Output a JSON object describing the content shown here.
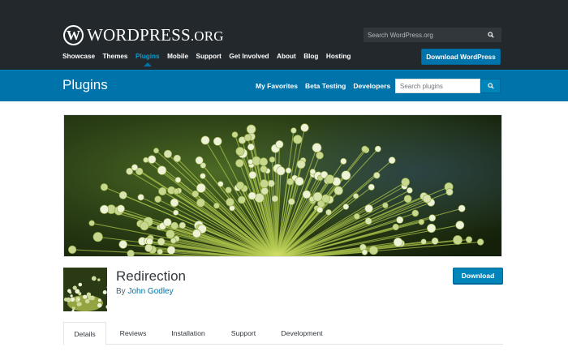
{
  "header": {
    "logo_mark": "W",
    "logo_text": "WORDPRESS",
    "logo_suffix": ".ORG",
    "search_placeholder": "Search WordPress.org",
    "search_icon": "search-icon",
    "nav": [
      {
        "label": "Showcase"
      },
      {
        "label": "Themes"
      },
      {
        "label": "Plugins"
      },
      {
        "label": "Mobile"
      },
      {
        "label": "Support"
      },
      {
        "label": "Get Involved"
      },
      {
        "label": "About"
      },
      {
        "label": "Blog"
      },
      {
        "label": "Hosting"
      }
    ],
    "active_nav": "Plugins",
    "cta_label": "Download WordPress"
  },
  "plugins_bar": {
    "title": "Plugins",
    "links": [
      {
        "label": "My Favorites"
      },
      {
        "label": "Beta Testing"
      },
      {
        "label": "Developers"
      }
    ],
    "search_placeholder": "Search plugins",
    "search_icon": "search-icon"
  },
  "plugin": {
    "name": "Redirection",
    "author_prefix": "By",
    "author": "John Godley",
    "download_label": "Download"
  },
  "tabs": [
    {
      "label": "Details"
    },
    {
      "label": "Reviews"
    },
    {
      "label": "Installation"
    },
    {
      "label": "Support"
    },
    {
      "label": "Development"
    }
  ],
  "active_tab": "Details",
  "colors": {
    "header_bg": "#23282d",
    "brand_blue": "#0073aa",
    "active_link": "#00a0d2",
    "button_blue": "#0085ba"
  }
}
